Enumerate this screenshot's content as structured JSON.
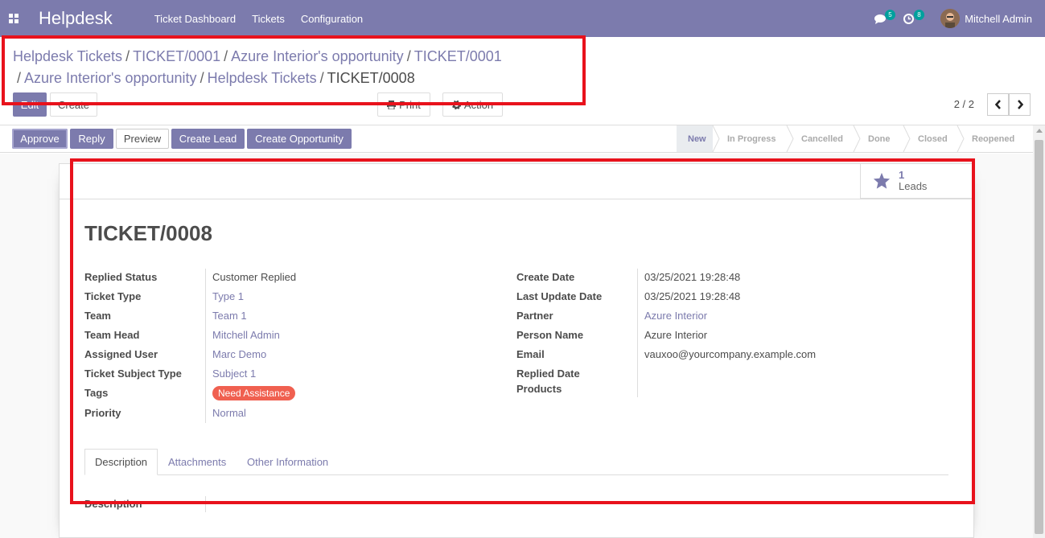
{
  "navbar": {
    "brand": "Helpdesk",
    "menu": [
      "Ticket Dashboard",
      "Tickets",
      "Configuration"
    ],
    "messages_count": "5",
    "activities_count": "8",
    "user_name": "Mitchell Admin"
  },
  "breadcrumb": {
    "items": [
      "Helpdesk Tickets",
      "TICKET/0001",
      "Azure Interior's opportunity",
      "TICKET/0001",
      "Azure Interior's opportunity",
      "Helpdesk Tickets"
    ],
    "current": "TICKET/0008"
  },
  "toolbar": {
    "edit": "Edit",
    "create": "Create",
    "print": "Print",
    "action": "Action",
    "pager": "2 / 2"
  },
  "statusbar": {
    "buttons": [
      "Approve",
      "Reply",
      "Preview",
      "Create Lead",
      "Create Opportunity"
    ],
    "stages": [
      "New",
      "In Progress",
      "Cancelled",
      "Done",
      "Closed",
      "Reopened"
    ],
    "current_stage": "New"
  },
  "smart_button": {
    "count": "1",
    "label": "Leads"
  },
  "record": {
    "title": "TICKET/0008",
    "left_fields": [
      {
        "label": "Replied Status",
        "value": "Customer Replied",
        "link": false
      },
      {
        "label": "Ticket Type",
        "value": "Type 1",
        "link": true
      },
      {
        "label": "Team",
        "value": "Team 1",
        "link": true
      },
      {
        "label": "Team Head",
        "value": "Mitchell Admin",
        "link": true
      },
      {
        "label": "Assigned User",
        "value": "Marc Demo",
        "link": true
      },
      {
        "label": "Ticket Subject Type",
        "value": "Subject 1",
        "link": true
      },
      {
        "label": "Tags",
        "value": "",
        "link": false
      },
      {
        "label": "Priority",
        "value": "Normal",
        "link": true
      }
    ],
    "tag": "Need Assistance",
    "right_fields": [
      {
        "label": "Create Date",
        "value": "03/25/2021 19:28:48",
        "link": false
      },
      {
        "label": "Last Update Date",
        "value": "03/25/2021 19:28:48",
        "link": false
      },
      {
        "label": "Partner",
        "value": "Azure Interior",
        "link": true
      },
      {
        "label": "Person Name",
        "value": "Azure Interior",
        "link": false
      },
      {
        "label": "Email",
        "value": "vauxoo@yourcompany.example.com",
        "link": false
      },
      {
        "label": "Replied Date",
        "value": "",
        "link": false
      },
      {
        "label": "Products",
        "value": "",
        "link": false
      }
    ],
    "tabs": [
      "Description",
      "Attachments",
      "Other Information"
    ],
    "description_label": "Description"
  },
  "colors": {
    "brand": "#7c7bad",
    "highlight": "#e8121c",
    "tag": "#f06050",
    "badge": "#00a09d"
  }
}
